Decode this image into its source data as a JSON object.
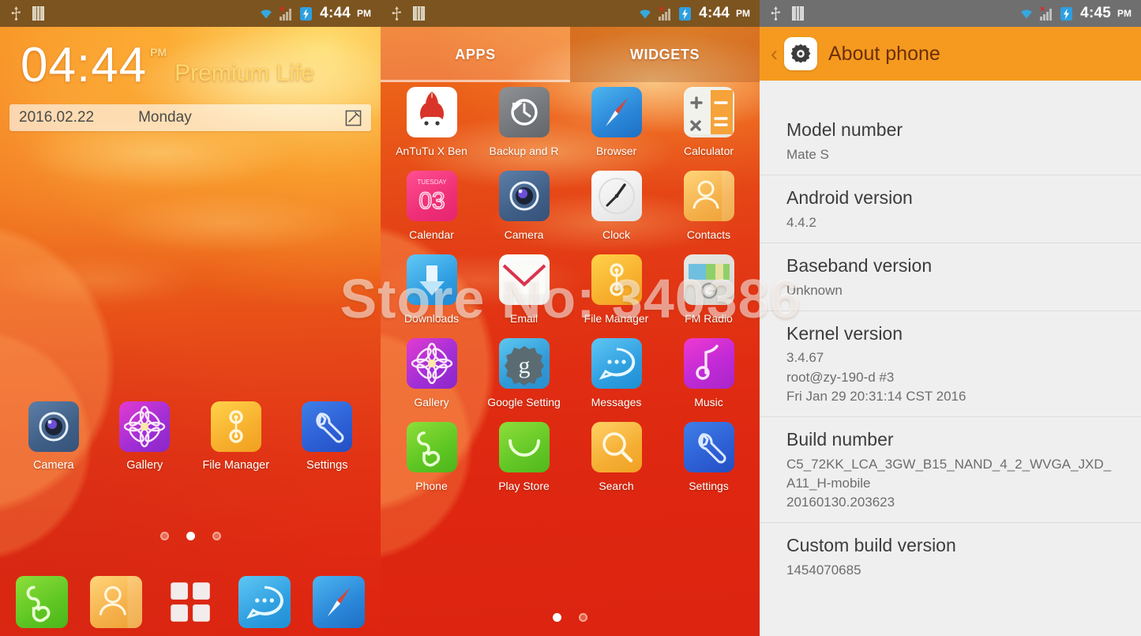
{
  "watermark": "Store No: 340386",
  "home": {
    "status_bar": {
      "time": "4:44",
      "ampm": "PM",
      "usb_icon": "usb-icon",
      "sim_icon": "sim-card-icon",
      "wifi_icon": "wifi-icon",
      "signal_icon": "signal-no-service-icon",
      "battery_icon": "battery-charging-icon"
    },
    "clock": {
      "time": "04:44",
      "ampm": "PM",
      "brand": "Premium Life"
    },
    "datebar": {
      "date": "2016.02.22",
      "day": "Monday",
      "edit_icon": "edit-note-icon"
    },
    "apps": [
      {
        "label": "Camera",
        "icon": "camera-icon"
      },
      {
        "label": "Gallery",
        "icon": "gallery-flower-icon"
      },
      {
        "label": "File Manager",
        "icon": "file-manager-icon"
      },
      {
        "label": "Settings",
        "icon": "settings-wrench-icon"
      }
    ],
    "page_dots": {
      "count": 3,
      "active": 1
    },
    "dock": [
      {
        "label": "Phone",
        "icon": "phone-handset-icon"
      },
      {
        "label": "Contacts",
        "icon": "contacts-person-icon"
      },
      {
        "label": "All apps",
        "icon": "app-drawer-grid-icon"
      },
      {
        "label": "Messages",
        "icon": "messages-bubble-icon"
      },
      {
        "label": "Browser",
        "icon": "browser-compass-icon"
      }
    ]
  },
  "drawer": {
    "status_bar": {
      "time": "4:44",
      "ampm": "PM"
    },
    "tabs": [
      {
        "label": "APPS",
        "active": true
      },
      {
        "label": "WIDGETS",
        "active": false
      }
    ],
    "apps": [
      {
        "label": "AnTuTu X Ben",
        "icon": "antutu-icon"
      },
      {
        "label": "Backup and R",
        "icon": "backup-restore-icon"
      },
      {
        "label": "Browser",
        "icon": "browser-compass-icon"
      },
      {
        "label": "Calculator",
        "icon": "calculator-icon"
      },
      {
        "label": "Calendar",
        "icon": "calendar-icon"
      },
      {
        "label": "Camera",
        "icon": "camera-icon"
      },
      {
        "label": "Clock",
        "icon": "clock-analog-icon"
      },
      {
        "label": "Contacts",
        "icon": "contacts-person-icon"
      },
      {
        "label": "Downloads",
        "icon": "downloads-arrow-icon"
      },
      {
        "label": "Email",
        "icon": "email-envelope-icon"
      },
      {
        "label": "File Manager",
        "icon": "file-manager-icon"
      },
      {
        "label": "FM Radio",
        "icon": "fm-radio-icon"
      },
      {
        "label": "Gallery",
        "icon": "gallery-flower-icon"
      },
      {
        "label": "Google Setting",
        "icon": "google-settings-icon"
      },
      {
        "label": "Messages",
        "icon": "messages-bubble-icon"
      },
      {
        "label": "Music",
        "icon": "music-note-icon"
      },
      {
        "label": "Phone",
        "icon": "phone-handset-icon"
      },
      {
        "label": "Play Store",
        "icon": "play-store-icon"
      },
      {
        "label": "Search",
        "icon": "search-magnifier-icon"
      },
      {
        "label": "Settings",
        "icon": "settings-wrench-icon"
      }
    ],
    "calendar_icon": {
      "weekday": "TUESDAY",
      "day": "03"
    },
    "page_dots": {
      "count": 2,
      "active": 0
    }
  },
  "about": {
    "status_bar": {
      "time": "4:45",
      "ampm": "PM"
    },
    "header": {
      "title": "About phone",
      "back_icon": "back-chevron-icon",
      "gear_icon": "settings-gear-icon"
    },
    "rows": [
      {
        "key": "Model number",
        "value": "Mate S"
      },
      {
        "key": "Android version",
        "value": "4.4.2"
      },
      {
        "key": "Baseband version",
        "value": "Unknown"
      },
      {
        "key": "Kernel version",
        "value": "3.4.67\nroot@zy-190-d #3\nFri Jan 29 20:31:14 CST 2016"
      },
      {
        "key": "Build number",
        "value": "C5_72KK_LCA_3GW_B15_NAND_4_2_WVGA_JXD_A11_H-mobile\n20160130.203623"
      },
      {
        "key": "Custom build version",
        "value": "1454070685"
      }
    ]
  }
}
